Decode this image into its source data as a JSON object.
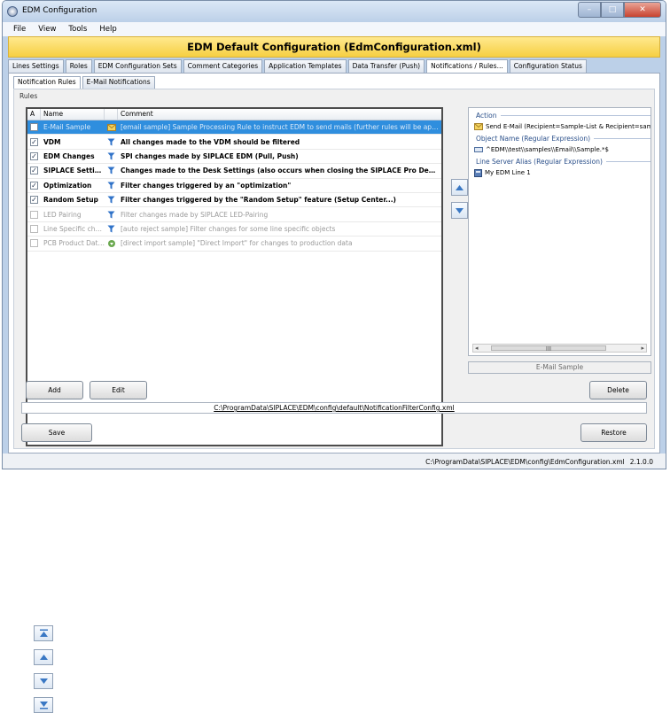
{
  "window": {
    "title": "EDM Configuration",
    "controls": {
      "minimize": "–",
      "maximize": "□",
      "close": "✕"
    }
  },
  "menu": [
    "File",
    "View",
    "Tools",
    "Help"
  ],
  "header": {
    "title": "EDM Default Configuration (EdmConfiguration.xml)"
  },
  "main_tabs": [
    "Lines Settings",
    "Roles",
    "EDM Configuration Sets",
    "Comment Categories",
    "Application Templates",
    "Data Transfer (Push)",
    "Notifications / Rules...",
    "Configuration Status"
  ],
  "sub_tabs": [
    "Notification Rules",
    "E-Mail Notifications"
  ],
  "rules_group_label": "Rules",
  "grid": {
    "columns": [
      "A",
      "Name",
      "",
      "Comment"
    ],
    "rows": [
      {
        "checked": false,
        "name": "E-Mail Sample",
        "icon": "email-icon",
        "comment": "[email sample] Sample Processing Rule to instruct EDM to send mails (further rules will be applied c...",
        "state": "selected"
      },
      {
        "checked": true,
        "name": "VDM",
        "icon": "filter-icon",
        "comment": "All changes made to the VDM should be filtered",
        "state": "active"
      },
      {
        "checked": true,
        "name": "EDM Changes",
        "icon": "filter-icon",
        "comment": "SPI changes made by SIPLACE EDM (Pull, Push)",
        "state": "active"
      },
      {
        "checked": true,
        "name": "SIPLACE Settin...",
        "icon": "filter-icon",
        "comment": "Changes made to the Desk Settings (also occurs when closing the SIPLACE Pro Des...",
        "state": "active"
      },
      {
        "checked": true,
        "name": "Optimization",
        "icon": "filter-icon",
        "comment": "Filter changes triggered by an \"optimization\"",
        "state": "active"
      },
      {
        "checked": true,
        "name": "Random Setup",
        "icon": "filter-icon",
        "comment": "Filter changes triggered by the \"Random Setup\" feature (Setup Center...)",
        "state": "active"
      },
      {
        "checked": false,
        "name": "LED Pairing",
        "icon": "filter-icon",
        "comment": "Filter changes made by SIPLACE LED-Pairing",
        "state": "disabled"
      },
      {
        "checked": false,
        "name": "Line Specific chan...",
        "icon": "filter-icon",
        "comment": "[auto reject sample] Filter changes for some line specific objects",
        "state": "disabled"
      },
      {
        "checked": false,
        "name": "PCB Product Data ...",
        "icon": "import-icon",
        "comment": "[direct import sample] \"Direct Import\" for changes to production data",
        "state": "disabled"
      }
    ]
  },
  "detail": {
    "action_label": "Action",
    "action_value": "Send E-Mail (Recipient=Sample-List & Recipient=sampl",
    "object_label": "Object Name (Regular Expression)",
    "object_value": "^EDM\\\\test\\\\samples\\\\Email\\\\Sample.*$",
    "alias_label": "Line Server Alias (Regular Expression)",
    "alias_value": "My EDM Line 1",
    "scroll_left": "◂",
    "scroll_right": "▸",
    "scroll_thumb": "III",
    "selected_rule_name": "E-Mail Sample"
  },
  "buttons": {
    "add": "Add",
    "edit": "Edit",
    "delete": "Delete",
    "save": "Save",
    "restore": "Restore"
  },
  "filter_config_path": "C:\\ProgramData\\SIPLACE\\EDM\\config\\default\\NotificationFilterConfig.xml",
  "status": {
    "config_path": "C:\\ProgramData\\SIPLACE\\EDM\\config\\EdmConfiguration.xml",
    "version": "2.1.0.0"
  },
  "legend": [
    "move-top-icon",
    "move-up-icon",
    "move-down-icon",
    "move-bottom-icon"
  ],
  "colors": {
    "header_band": "#f6cf42",
    "selection": "#2f8ede",
    "section_heading": "#2a4f8a"
  }
}
